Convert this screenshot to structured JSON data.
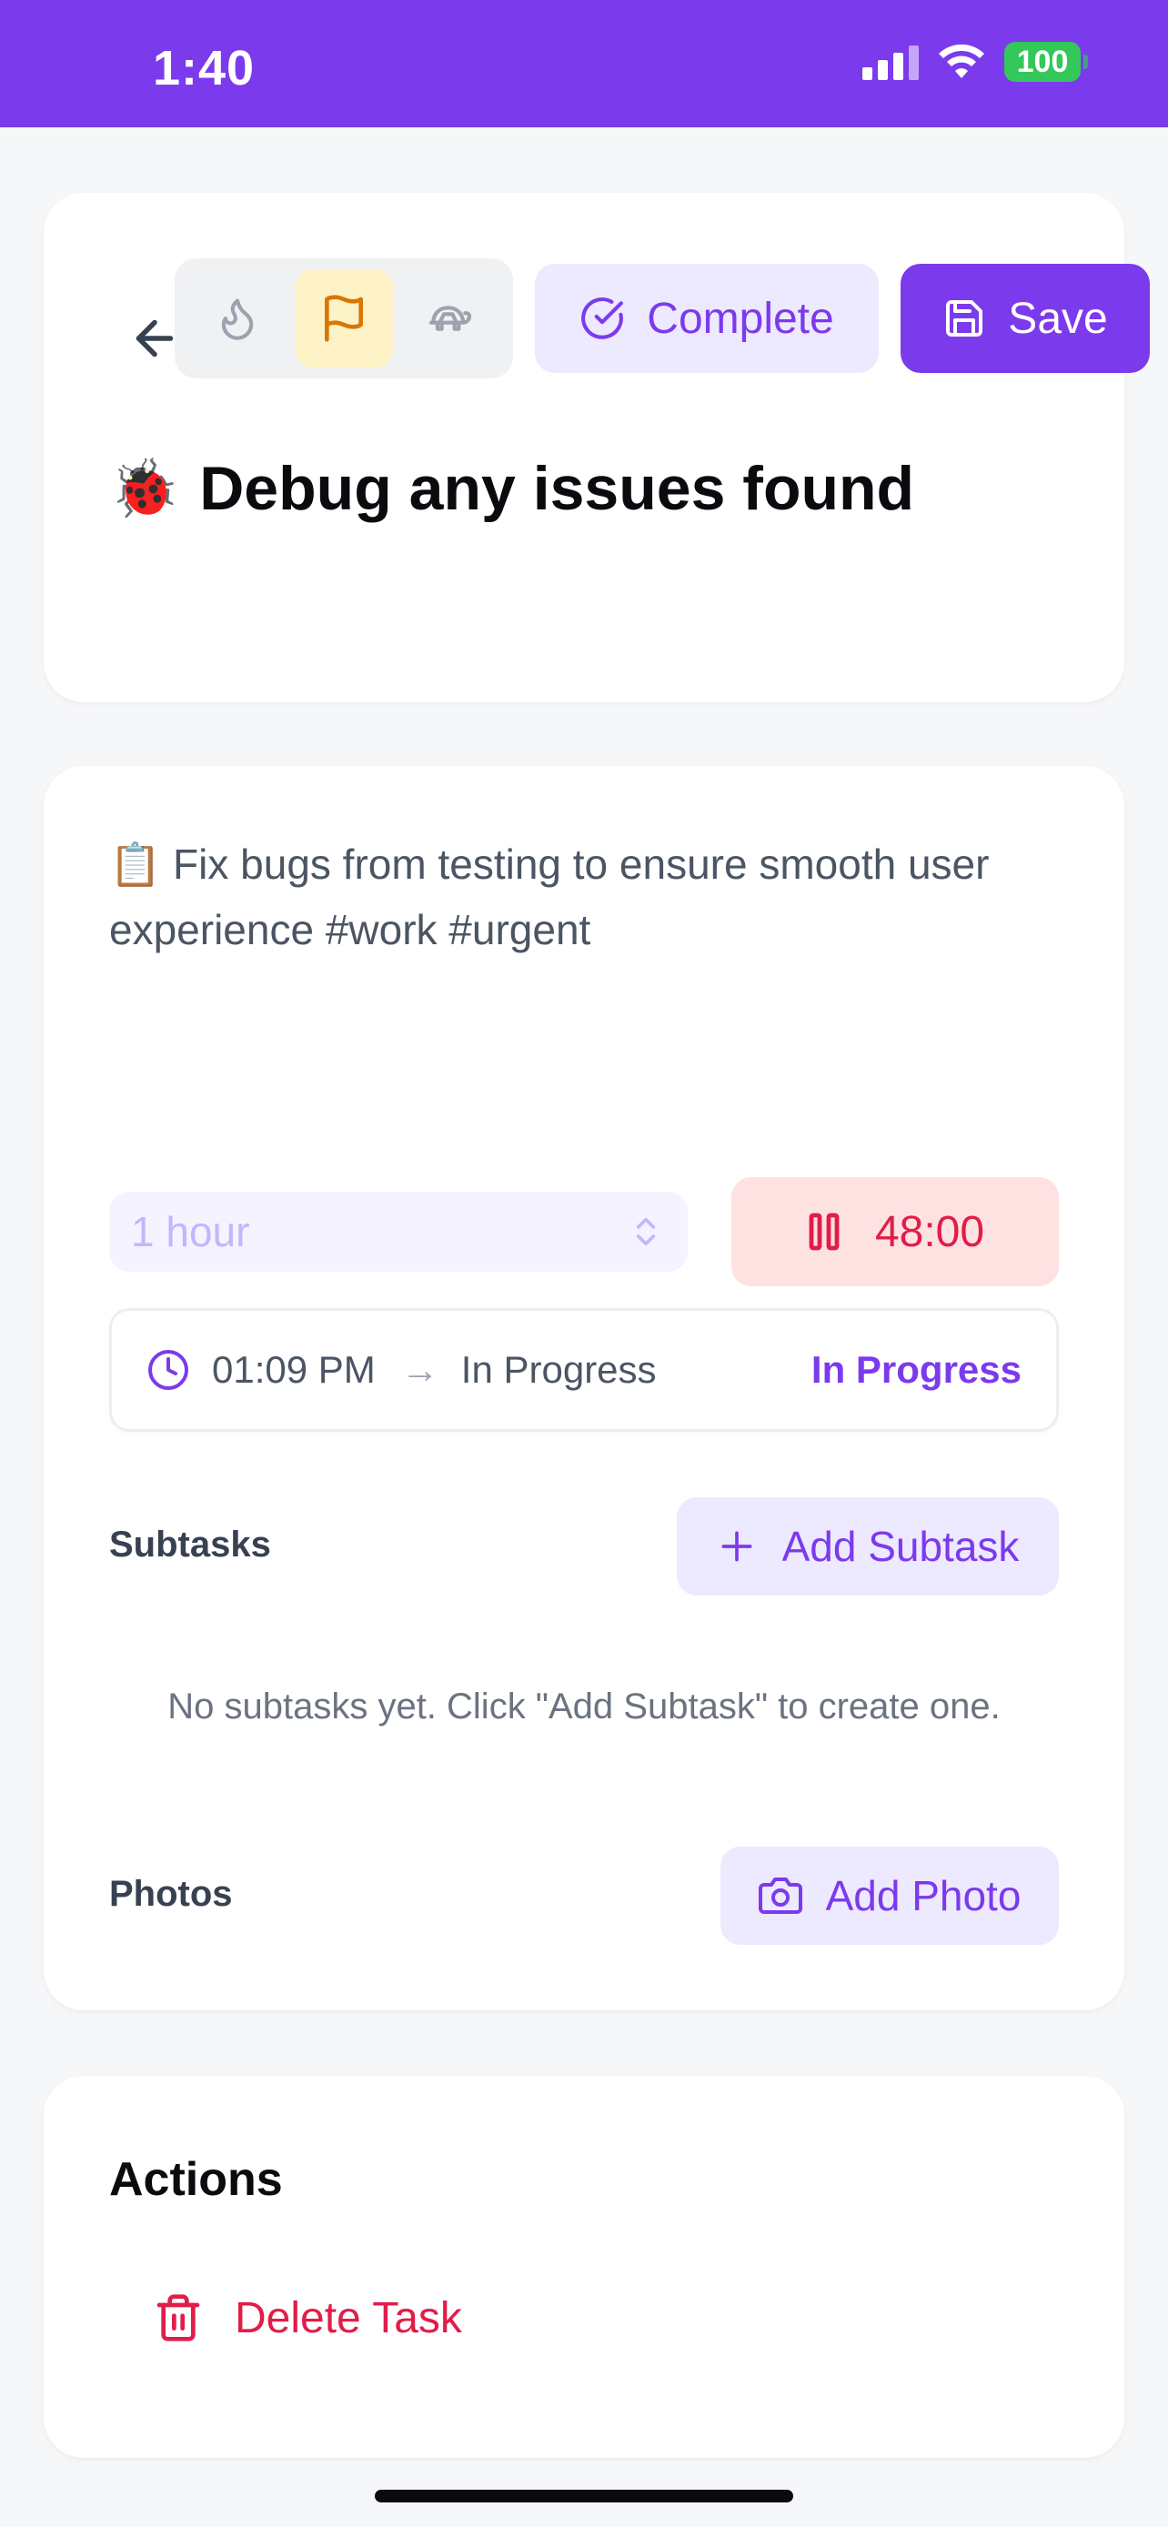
{
  "status_bar": {
    "time": "1:40",
    "battery_level": "100",
    "icons": [
      "cellular-signal-icon",
      "wifi-icon",
      "battery-icon"
    ]
  },
  "header": {
    "icons": {
      "back": "arrow-left-icon",
      "priority_high": "flame-icon",
      "priority_medium": "flag-icon",
      "priority_low": "turtle-icon"
    },
    "selected_priority": "medium",
    "complete_label": "Complete",
    "save_label": "Save",
    "title_emoji": "🐞",
    "title": "Debug any issues found"
  },
  "details": {
    "description": "📋 Fix bugs from testing to ensure smooth user experience #work #urgent",
    "duration": {
      "selected": "1 hour",
      "icon": "chevron-up-down-icon"
    },
    "timer": {
      "value": "48:00",
      "icon": "pause-icon"
    },
    "status": {
      "start_time": "01:09 PM",
      "arrow": "→",
      "state_text": "In Progress",
      "badge": "In Progress"
    },
    "subtasks": {
      "label": "Subtasks",
      "add_label": "Add Subtask",
      "empty_text": "No subtasks yet. Click \"Add Subtask\" to create one."
    },
    "photos": {
      "label": "Photos",
      "add_label": "Add Photo"
    }
  },
  "actions": {
    "title": "Actions",
    "delete_label": "Delete Task"
  },
  "colors": {
    "accent": "#7c3aed",
    "accent_light": "#ede9fe",
    "danger": "#e11d48",
    "danger_light": "#fee2e2",
    "priority_active_bg": "#fef3c7",
    "priority_active_icon": "#d97706",
    "battery_green": "#34c759"
  }
}
